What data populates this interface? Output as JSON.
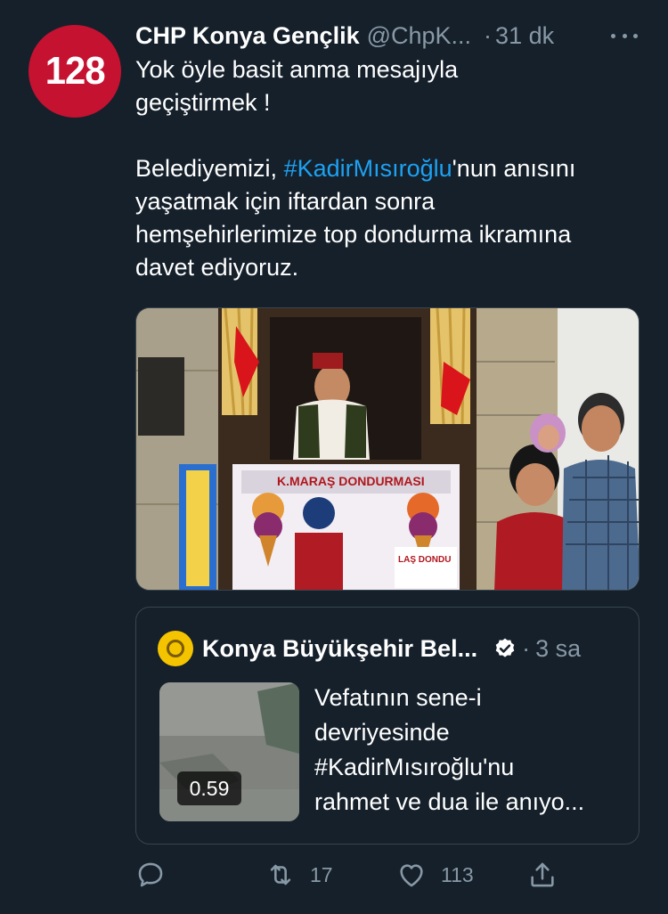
{
  "tweet": {
    "avatar_text": "128",
    "author_name": "CHP Konya Gençlik",
    "author_handle": "@ChpK...",
    "separator": "·",
    "time": "31 dk",
    "more_icon": "more-icon",
    "lines": [
      "Yok öyle basit anma mesajıyla",
      "geçiştirmek !"
    ],
    "para2_prefix": "Belediyemizi, ",
    "hashtag": "#KadirMısıroğlu",
    "para2_suffix": "'nun anısını",
    "para2_lines": [
      "yaşatmak için iftardan sonra",
      "hemşehirlerimize top dondurma ikramına",
      "davet ediyoruz."
    ],
    "photo": {
      "stand_sign": "K.MARAŞ DONDURMASI",
      "stand_sign_small": "LAŞ DONDU"
    }
  },
  "quoted": {
    "author_name": "Konya Büyükşehir Bel...",
    "verified_icon": "verified-badge-icon",
    "separator": "·",
    "time": "3 sa",
    "video_duration": "0.59",
    "text_lines": [
      "Vefatının sene-i",
      "devriyesinde",
      "#KadirMısıroğlu'nu",
      "rahmet ve dua ile anıyo..."
    ]
  },
  "actions": {
    "reply_icon": "reply-icon",
    "retweet_icon": "retweet-icon",
    "retweet_count": "17",
    "like_icon": "like-icon",
    "like_count": "113",
    "share_icon": "share-icon"
  },
  "colors": {
    "background": "#15202b",
    "text": "#ffffff",
    "secondary": "#8899a6",
    "link": "#1da1f2",
    "border": "#38444d",
    "avatar_red": "#c41230"
  }
}
